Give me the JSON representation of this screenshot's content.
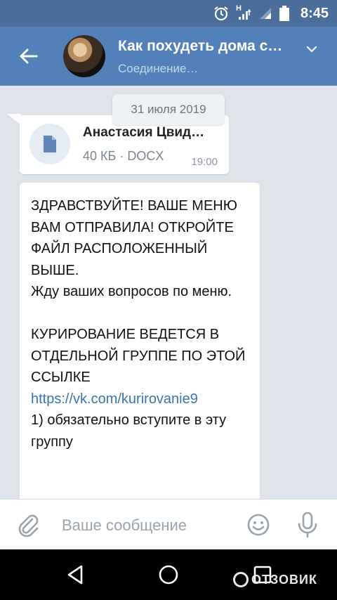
{
  "status_bar": {
    "time": "8:45",
    "network_label": "H"
  },
  "header": {
    "chat_title": "Как похудеть дома с…",
    "chat_status": "Соединение…"
  },
  "messages": {
    "date_separator": "31 июля 2019",
    "file_message": {
      "file_name": "Анастасия Цвид…",
      "file_meta": "40 КБ · DOCX",
      "time": "19:00"
    },
    "text_message": {
      "text_part1": "ЗДРАВСТВУЙТЕ! ВАШЕ МЕНЮ ВАМ ОТПРАВИЛА! ОТКРОЙТЕ ФАЙЛ РАСПОЛОЖЕННЫЙ ВЫШЕ.\nЖду ваших вопросов по меню.\n\nКУРИРОВАНИЕ ВЕДЕТСЯ В ОТДЕЛЬНОЙ ГРУППЕ ПО ЭТОЙ ССЫЛКЕ ",
      "link": "https://vk.com/kurirovanie9",
      "text_part2": "\n1) обязательно вступите в эту группу"
    }
  },
  "composer": {
    "placeholder": "Ваше сообщение"
  },
  "watermark": {
    "text": "ОТЗОВИК"
  },
  "colors": {
    "header_bg": "#5181b8",
    "status_bg": "#4a6e9a",
    "link": "#3b74b0"
  }
}
